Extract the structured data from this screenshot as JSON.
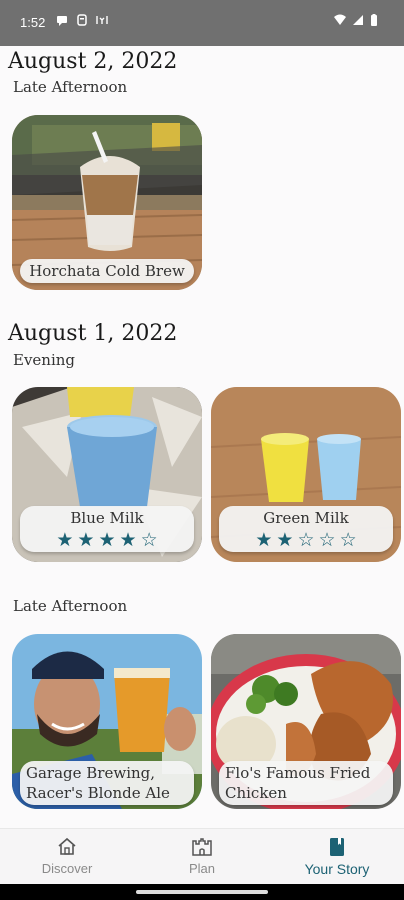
{
  "status_bar": {
    "time": "1:52"
  },
  "sections": [
    {
      "date": "August 2, 2022",
      "period": "Late Afternoon",
      "items": [
        {
          "name": "Horchata Cold Brew"
        }
      ]
    },
    {
      "date": "August 1, 2022",
      "period": "Evening",
      "items": [
        {
          "name": "Blue Milk",
          "rating": 4,
          "stars": "★★★★☆"
        },
        {
          "name": "Green Milk",
          "rating": 2,
          "stars": "★★☆☆☆"
        }
      ]
    },
    {
      "period": "Late Afternoon",
      "items": [
        {
          "name": "Garage Brewing, Racer's Blonde Ale"
        },
        {
          "name": "Flo's Famous Fried Chicken"
        }
      ]
    }
  ],
  "nav": {
    "items": [
      {
        "label": "Discover",
        "icon": "home-icon"
      },
      {
        "label": "Plan",
        "icon": "castle-icon"
      },
      {
        "label": "Your Story",
        "icon": "book-icon",
        "active": true
      }
    ]
  },
  "colors": {
    "accent": "#1d6274",
    "status_bar": "#707070",
    "background": "#fbfafb"
  }
}
